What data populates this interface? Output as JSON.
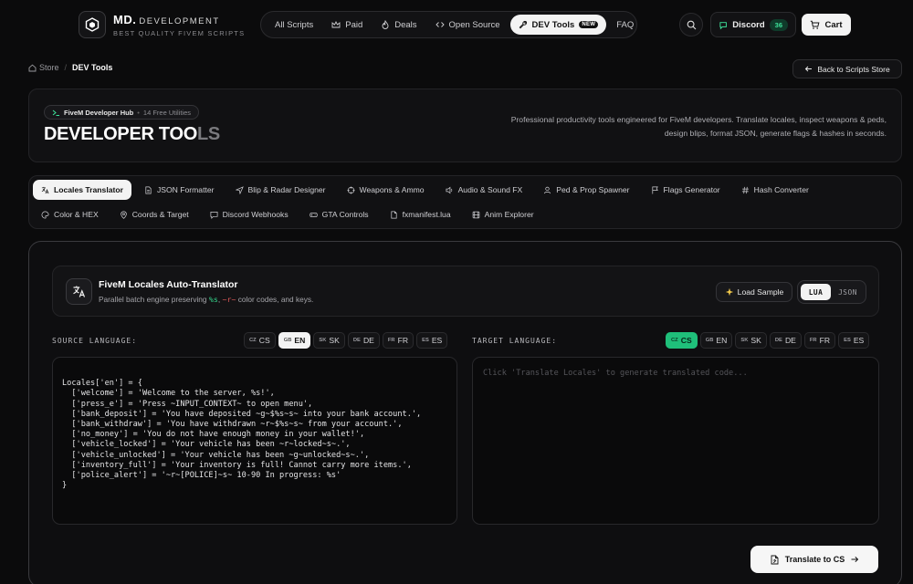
{
  "brand": {
    "name": "MD.",
    "suffix": "DEVELOPMENT",
    "tagline": "BEST QUALITY FIVEM SCRIPTS"
  },
  "nav": {
    "items": [
      {
        "label": "All Scripts",
        "icon": "grid-icon"
      },
      {
        "label": "Paid",
        "icon": "crown-icon"
      },
      {
        "label": "Deals",
        "icon": "flame-icon"
      },
      {
        "label": "Open Source",
        "icon": "code-icon"
      },
      {
        "label": "DEV Tools",
        "icon": "wrench-icon",
        "badge": "NEW",
        "active": true
      },
      {
        "label": "FAQ",
        "icon": ""
      }
    ]
  },
  "header": {
    "discord_label": "Discord",
    "discord_count": "36",
    "cart_label": "Cart"
  },
  "breadcrumb": {
    "root": "Store",
    "separator": "/",
    "current": "DEV Tools"
  },
  "back_button": "Back to Scripts Store",
  "hero": {
    "chip_hub": "FiveM Developer Hub",
    "chip_dot": "•",
    "chip_count": "14 Free Utilities",
    "title_main": "DEVELOPER TOO",
    "title_fade": "LS",
    "description": "Professional productivity tools engineered for FiveM developers. Translate locales, inspect weapons & peds, design blips, format JSON, generate flags & hashes in seconds."
  },
  "tools": {
    "row1": [
      {
        "label": "Locales Translator",
        "icon": "translate-icon",
        "active": true
      },
      {
        "label": "JSON Formatter",
        "icon": "file-icon"
      },
      {
        "label": "Blip & Radar Designer",
        "icon": "navigation-icon"
      },
      {
        "label": "Weapons & Ammo",
        "icon": "crosshair-icon"
      },
      {
        "label": "Audio & Sound FX",
        "icon": "speaker-icon"
      },
      {
        "label": "Ped & Prop Spawner",
        "icon": "user-icon"
      },
      {
        "label": "Flags Generator",
        "icon": "flag-icon"
      },
      {
        "label": "Hash Converter",
        "icon": "hash-icon"
      }
    ],
    "row2": [
      {
        "label": "Color & HEX",
        "icon": "palette-icon"
      },
      {
        "label": "Coords & Target",
        "icon": "pin-icon"
      },
      {
        "label": "Discord Webhooks",
        "icon": "message-icon"
      },
      {
        "label": "GTA Controls",
        "icon": "gamepad-icon"
      },
      {
        "label": "fxmanifest.lua",
        "icon": "file-text-icon"
      },
      {
        "label": "Anim Explorer",
        "icon": "film-icon"
      }
    ]
  },
  "translator": {
    "title": "FiveM Locales Auto-Translator",
    "subtitle_before": "Parallel batch engine preserving ",
    "subtitle_code1": "%s",
    "subtitle_mid": ", ",
    "subtitle_code2": "~r~",
    "subtitle_after": " color codes, and keys.",
    "load_sample": "Load Sample",
    "formats": [
      "LUA",
      "JSON"
    ],
    "active_format": "LUA",
    "source_label": "SOURCE LANGUAGE:",
    "target_label": "TARGET LANGUAGE:",
    "source_langs": [
      {
        "cc": "CZ",
        "code": "CS"
      },
      {
        "cc": "GB",
        "code": "EN",
        "active": true
      },
      {
        "cc": "SK",
        "code": "SK"
      },
      {
        "cc": "DE",
        "code": "DE"
      },
      {
        "cc": "FR",
        "code": "FR"
      },
      {
        "cc": "ES",
        "code": "ES"
      }
    ],
    "target_langs": [
      {
        "cc": "CZ",
        "code": "CS",
        "active": true
      },
      {
        "cc": "GB",
        "code": "EN"
      },
      {
        "cc": "SK",
        "code": "SK"
      },
      {
        "cc": "DE",
        "code": "DE"
      },
      {
        "cc": "FR",
        "code": "FR"
      },
      {
        "cc": "ES",
        "code": "ES"
      }
    ],
    "source_code": [
      "Locales['en'] = {",
      "  ['welcome'] = 'Welcome to the server, %s!',",
      "  ['press_e'] = 'Press ~INPUT_CONTEXT~ to open menu',",
      "  ['bank_deposit'] = 'You have deposited ~g~$%s~s~ into your bank account.',",
      "  ['bank_withdraw'] = 'You have withdrawn ~r~$%s~s~ from your account.',",
      "  ['no_money'] = 'You do not have enough money in your wallet!',",
      "  ['vehicle_locked'] = 'Your vehicle has been ~r~locked~s~.',",
      "  ['vehicle_unlocked'] = 'Your vehicle has been ~g~unlocked~s~.',",
      "  ['inventory_full'] = 'Your inventory is full! Cannot carry more items.',",
      "  ['police_alert'] = '~r~[POLICE]~s~ 10-90 In progress: %s'",
      "}"
    ],
    "target_placeholder": "Click 'Translate Locales' to generate translated code...",
    "translate_button": "Translate to CS"
  },
  "colors": {
    "accent_green": "#1fbf7a",
    "background": "#0b0b0c",
    "active_pill": "#f3f3f3"
  }
}
